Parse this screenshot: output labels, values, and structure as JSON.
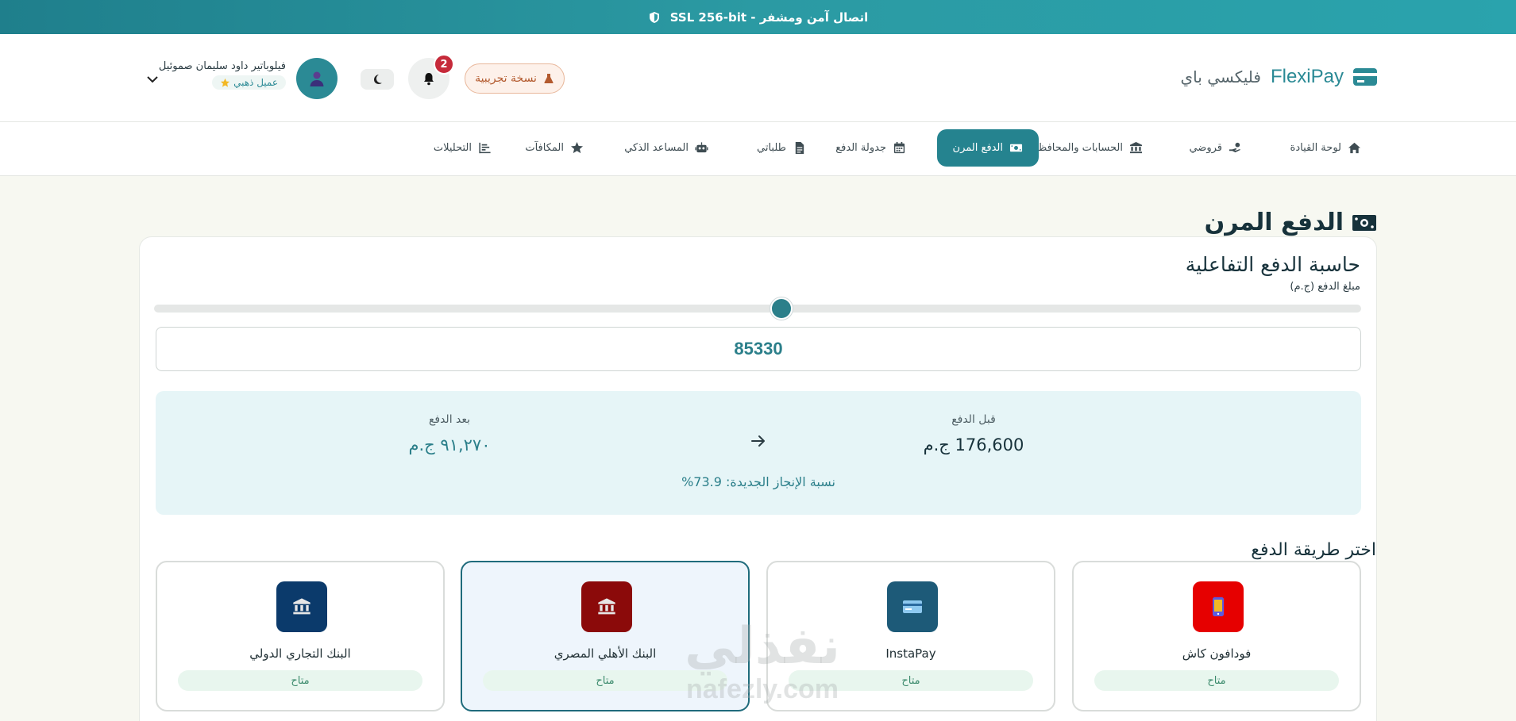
{
  "banner": {
    "text": "اتصال آمن ومشفر - SSL 256-bit",
    "icon": "shield-icon"
  },
  "brand": {
    "name_en": "FlexiPay",
    "name_ar": "فليكسي باي",
    "icon": "credit-card-icon",
    "color": "#2b8a95"
  },
  "header": {
    "trial_label": "نسخة تجريبية",
    "notifications_count": "2",
    "user": {
      "name": "فيلوباتير داود سليمان صموئيل",
      "tier": "عميل ذهبي"
    }
  },
  "nav": {
    "items": [
      {
        "label": "لوحة القيادة",
        "icon": "home-icon"
      },
      {
        "label": "قروضي",
        "icon": "hand-money-icon"
      },
      {
        "label": "الحسابات والمحافظ",
        "icon": "bank-icon"
      },
      {
        "label": "الدفع المرن",
        "icon": "money-bill-icon",
        "active": true
      },
      {
        "label": "جدولة الدفع",
        "icon": "calendar-icon"
      },
      {
        "label": "طلباتي",
        "icon": "file-icon"
      },
      {
        "label": "المساعد الذكي",
        "icon": "robot-icon"
      },
      {
        "label": "المكافآت",
        "icon": "star-icon"
      },
      {
        "label": "التحليلات",
        "icon": "chart-icon"
      }
    ]
  },
  "page": {
    "title": "الدفع المرن"
  },
  "calculator": {
    "title": "حاسبة الدفع التفاعلية",
    "amount_label": "مبلغ الدفع (ج.م)",
    "slider_fraction": 0.52,
    "amount_value": "85330",
    "before_label": "قبل الدفع",
    "before_value": "176,600 ج.م",
    "after_label": "بعد الدفع",
    "after_value": "٩١,٢٧٠ ج.م",
    "completion_text": "نسبة الإنجاز الجديدة: 73.9%"
  },
  "payment_methods": {
    "title": "اختر طريقة الدفع",
    "items": [
      {
        "name": "فودافون كاش",
        "status": "متاح",
        "color": "#e60000",
        "icon": "phone-icon"
      },
      {
        "name": "InstaPay",
        "status": "متاح",
        "color": "#1d5a78",
        "icon": "card-icon"
      },
      {
        "name": "البنك الأهلي المصري",
        "status": "متاح",
        "color": "#8b0a0a",
        "icon": "bank-icon",
        "selected": true
      },
      {
        "name": "البنك التجاري الدولي",
        "status": "متاح",
        "color": "#0b3a6b",
        "icon": "bank-icon"
      }
    ]
  },
  "watermark": {
    "ar": "نفذلي",
    "en": "nafezly.com"
  }
}
